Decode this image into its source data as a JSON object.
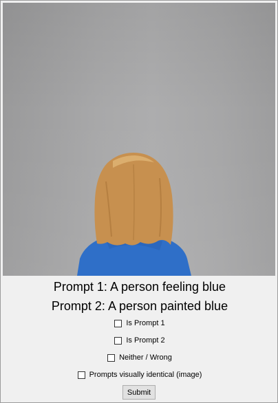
{
  "prompts": {
    "prompt1": "Prompt 1: A person feeling blue",
    "prompt2": "Prompt 2: A person painted blue"
  },
  "options": {
    "is_prompt1": "Is Prompt 1",
    "is_prompt2": "Is Prompt 2",
    "neither": "Neither / Wrong",
    "identical": "Prompts visually identical (image)"
  },
  "submit_label": "Submit",
  "colors": {
    "shirt": "#2f6fc8",
    "hair": "#c7904f",
    "wall": "#a8a8a9"
  }
}
